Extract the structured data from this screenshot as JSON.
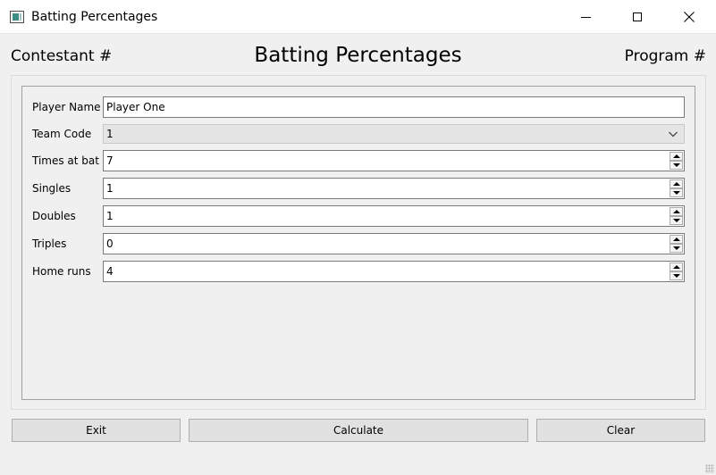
{
  "window": {
    "title": "Batting Percentages",
    "icon": "app-window-icon",
    "controls": [
      "minimize-icon",
      "maximize-icon",
      "close-icon"
    ]
  },
  "header": {
    "left": "Contestant #",
    "center": "Batting Percentages",
    "right": "Program #"
  },
  "form": {
    "player_name": {
      "label": "Player Name",
      "value": "Player One"
    },
    "team_code": {
      "label": "Team Code",
      "value": "1"
    },
    "times_at_bat": {
      "label": "Times at bat",
      "value": "7"
    },
    "singles": {
      "label": "Singles",
      "value": "1"
    },
    "doubles": {
      "label": "Doubles",
      "value": "1"
    },
    "triples": {
      "label": "Triples",
      "value": "0"
    },
    "home_runs": {
      "label": "Home runs",
      "value": "4"
    }
  },
  "buttons": {
    "exit": "Exit",
    "calculate": "Calculate",
    "clear": "Clear"
  },
  "colors": {
    "window_bg": "#f0f0f0",
    "titlebar_bg": "#ffffff",
    "button_bg": "#e1e1e1",
    "combo_bg": "#e5e5e5"
  }
}
